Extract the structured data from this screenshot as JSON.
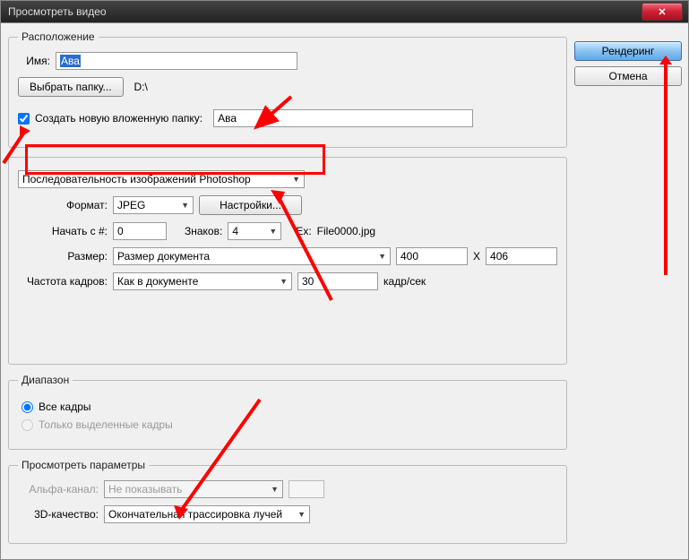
{
  "window": {
    "title": "Просмотреть видео"
  },
  "buttons": {
    "render": "Рендеринг",
    "cancel": "Отмена",
    "choose_folder": "Выбрать папку...",
    "settings": "Настройки..."
  },
  "location": {
    "legend": "Расположение",
    "name_label": "Имя:",
    "name_value": "Ава",
    "path": "D:\\",
    "subfolder_check": "Создать новую вложенную папку:",
    "subfolder_value": "Ава"
  },
  "sequence": {
    "type": "Последовательность изображений Photoshop",
    "format_label": "Формат:",
    "format_value": "JPEG",
    "start_label": "Начать с #:",
    "start_value": "0",
    "digits_label": "Знаков:",
    "digits_value": "4",
    "example_label": "Ex:",
    "example_value": "File0000.jpg",
    "size_label": "Размер:",
    "size_value": "Размер документа",
    "width": "400",
    "x": "X",
    "height": "406",
    "framerate_label": "Частота кадров:",
    "framerate_mode": "Как в документе",
    "framerate_value": "30",
    "framerate_unit": "кадр/сек"
  },
  "range": {
    "legend": "Диапазон",
    "all": "Все кадры",
    "selected": "Только выделенные кадры"
  },
  "preview": {
    "legend": "Просмотреть параметры",
    "alpha_label": "Альфа-канал:",
    "alpha_value": "Не показывать",
    "quality_label": "3D-качество:",
    "quality_value": "Окончательная трассировка лучей"
  }
}
